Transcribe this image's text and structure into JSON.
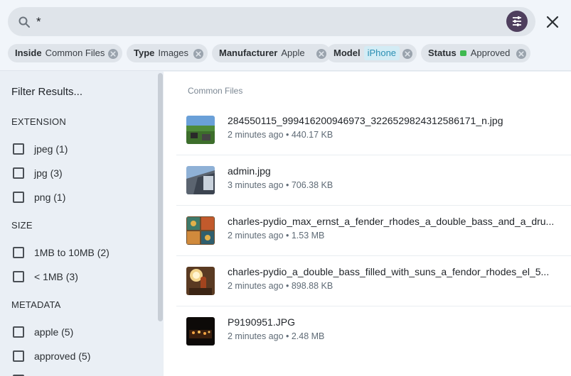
{
  "search": {
    "value": "*",
    "placeholder": ""
  },
  "chips": [
    {
      "key": "Inside",
      "value": "Common Files"
    },
    {
      "key": "Type",
      "value": "Images"
    },
    {
      "key": "Manufacturer",
      "value": "Apple"
    },
    {
      "key": "Model",
      "value": "iPhone"
    },
    {
      "key": "Status",
      "value": "Approved"
    }
  ],
  "sidebar": {
    "title": "Filter Results...",
    "sections": [
      {
        "heading": "EXTENSION",
        "items": [
          "jpeg (1)",
          "jpg (3)",
          "png (1)"
        ]
      },
      {
        "heading": "SIZE",
        "items": [
          "1MB to 10MB (2)",
          "< 1MB (3)"
        ]
      },
      {
        "heading": "METADATA",
        "items": [
          "apple (5)",
          "approved (5)"
        ]
      }
    ]
  },
  "main": {
    "folder": "Common Files",
    "files": [
      {
        "name": "284550115_999416200946973_3226529824312586171_n.jpg",
        "meta": "2 minutes ago • 440.17 KB"
      },
      {
        "name": "admin.jpg",
        "meta": "3 minutes ago • 706.38 KB"
      },
      {
        "name": "charles-pydio_max_ernst_a_fender_rhodes_a_double_bass_and_a_dru...",
        "meta": "2 minutes ago • 1.53 MB"
      },
      {
        "name": "charles-pydio_a_double_bass_filled_with_suns_a_fendor_rhodes_el_5...",
        "meta": "2 minutes ago • 898.88 KB"
      },
      {
        "name": "P9190951.JPG",
        "meta": "2 minutes ago • 2.48 MB"
      }
    ]
  },
  "colors": {
    "accent": "#4f3f5e",
    "status_approved": "#3fb950",
    "model_badge": "#d3ecf5"
  },
  "icons": {
    "search": "search-icon",
    "tune": "tune-icon",
    "close": "close-icon",
    "chip_remove": "cancel-circle-icon"
  }
}
